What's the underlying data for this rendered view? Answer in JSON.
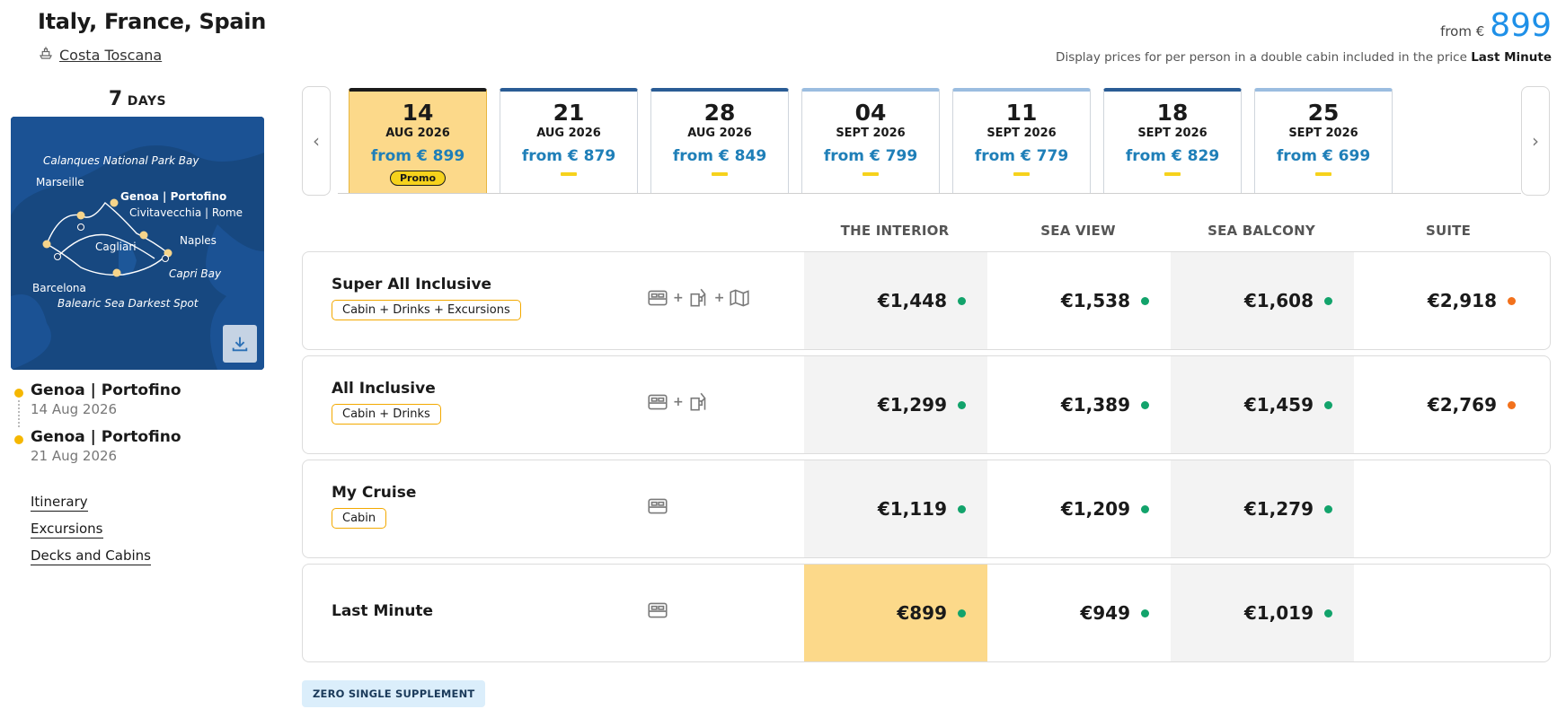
{
  "cruise": {
    "title": "Italy, France, Spain",
    "ship": "Costa Toscana",
    "days_num": "7",
    "days_label": "DAYS"
  },
  "price_header": {
    "from_label": "from €",
    "amount": "899",
    "note_prefix": "Display prices for per person in a double cabin included in the price",
    "note_bold": "Last Minute"
  },
  "map": {
    "labels": {
      "calanques": "Calanques National Park Bay",
      "marseille": "Marseille",
      "genoa": "Genoa | Portofino",
      "civitavecchia": "Civitavecchia | Rome",
      "naples": "Naples",
      "cagliari": "Cagliari",
      "capri": "Capri Bay",
      "barcelona": "Barcelona",
      "balearic": "Balearic Sea Darkest Spot"
    }
  },
  "stops": [
    {
      "port": "Genoa | Portofino",
      "date": "14 Aug 2026"
    },
    {
      "port": "Genoa | Portofino",
      "date": "21 Aug 2026"
    }
  ],
  "links": {
    "itinerary": "Itinerary",
    "excursions": "Excursions",
    "decks": "Decks and Cabins"
  },
  "dates": [
    {
      "day": "14",
      "month": "AUG 2026",
      "from": "from € 899",
      "badge": "Promo"
    },
    {
      "day": "21",
      "month": "AUG 2026",
      "from": "from € 879"
    },
    {
      "day": "28",
      "month": "AUG 2026",
      "from": "from € 849"
    },
    {
      "day": "04",
      "month": "SEPT 2026",
      "from": "from € 799"
    },
    {
      "day": "11",
      "month": "SEPT 2026",
      "from": "from € 779"
    },
    {
      "day": "18",
      "month": "SEPT 2026",
      "from": "from € 829"
    },
    {
      "day": "25",
      "month": "SEPT 2026",
      "from": "from € 699"
    }
  ],
  "cabin_types": [
    "THE INTERIOR",
    "SEA VIEW",
    "SEA BALCONY",
    "SUITE"
  ],
  "fares": [
    {
      "name": "Super All Inclusive",
      "tag": "Cabin + Drinks + Excursions",
      "prices": [
        "€1,448",
        "€1,538",
        "€1,608",
        "€2,918"
      ]
    },
    {
      "name": "All Inclusive",
      "tag": "Cabin + Drinks",
      "prices": [
        "€1,299",
        "€1,389",
        "€1,459",
        "€2,769"
      ]
    },
    {
      "name": "My Cruise",
      "tag": "Cabin",
      "prices": [
        "€1,119",
        "€1,209",
        "€1,279",
        ""
      ]
    },
    {
      "name": "Last Minute",
      "prices": [
        "€899",
        "€949",
        "€1,019",
        ""
      ]
    }
  ],
  "status_colors": {
    "available": "#12a36b",
    "limited": "#f2711c"
  },
  "accent_colors": {
    "price_blue": "#1e90e8",
    "highlight": "#fcd98a",
    "tag_border": "#f3a900"
  },
  "badge": "ZERO SINGLE SUPPLEMENT",
  "nav": {
    "prev": "‹",
    "next": "›"
  }
}
